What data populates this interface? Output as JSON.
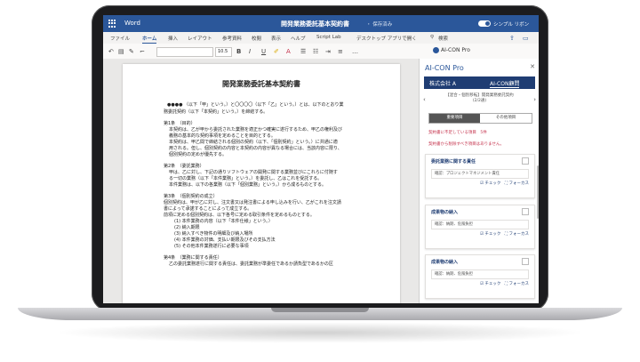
{
  "titlebar": {
    "app": "Word",
    "doc_title": "開発業務委託基本契約書",
    "saved": "・ 保存済み",
    "simple_ribbon": "シンプル リボン"
  },
  "tabs": [
    "ファイル",
    "ホーム",
    "挿入",
    "レイアウト",
    "参考資料",
    "校閲",
    "表示",
    "ヘルプ",
    "Script Lab",
    "デスクトップ アプリで開く",
    "検索"
  ],
  "toolbar": {
    "font_size": "10.5",
    "bold": "B",
    "italic": "I",
    "underline": "U",
    "addin": "AI-CON Pro"
  },
  "document": {
    "title": "開発業務委託基本契約書",
    "lines": [
      "●●●● （以下「甲」という。）と〇〇〇〇（以下「乙」という。）とは、以下のとおり業",
      "務委託契約（以下「本契約」という。）を締結する。",
      "第1条　（目的）",
      "本契約は、乙が甲から委託された業務を適正かつ確実に遂行するため、甲乙の権利及び",
      "義務の基本的な契約事項を定めることを目的とする。",
      "本契約は、甲乙間で締結される個別の契約（以下、「個別契約」という。）に共通に適",
      "用される。但し、個別契約の内容と本契約の内容が異なる場合には、当該内容に限り、",
      "個別契約の定めが優先する。",
      "第2条　（委託業務）",
      "甲は、乙に対し、下記の通りソフトウェアの開発に関する業務並びにこれらに付随す",
      "る一切の業務（以下「本件業務」という。）を委託し、乙はこれを受託する。",
      "本件業務は、以下の各業務（以下「個別業務」という。）から成るものとする。",
      "第3条　（個別契約の成立）",
      "個別契約は、甲が乙に対し、注文書又は発注書による申し込みを行い、乙がこれを注文請",
      "書によって承諾することによって成立する。",
      "前項に定める個別契約は、以下各号に定める取引条件を定めるものとする。",
      "(1) 本件業務の内容（以下「本件仕様」という。）",
      "(2) 納入期限",
      "(3) 納入すべき物件の明細及び納入場所",
      "(4) 本件業務の対価、支払い期限及びその支払方法",
      "(5) その他本件業務遂行に必要な事項",
      "第4条　（業務に関する責任）",
      "乙の委託業務遂行に関する責任は、委託業務が準委任であるか請負型であるかの区"
    ]
  },
  "panel": {
    "header": "AI-CON Pro",
    "company": "株式会社 A",
    "party": "AI-CON顧問",
    "nav_title_1": "【混合・個別移転】開発業務委託契約",
    "nav_title_2": "(2/2通)",
    "tab_main": "重要項目",
    "tab_other": "その他項目",
    "warn_1": "契約書に不足している項目　5件",
    "warn_2": "契約書から削除すべき項目はありません。",
    "cards": [
      {
        "title": "委託業務に関する責任",
        "body": "確認：プロジェクトマネジメント責任",
        "actions": "☑ チェック　⛶ フォーカス"
      },
      {
        "title": "成果物の納入",
        "body": "確認：納期、危険負担",
        "actions": "☑ チェック　⛶ フォーカス"
      },
      {
        "title": "成果物の納入",
        "body": "確認：納期、危険負担",
        "actions": "☑ チェック　⛶ フォーカス"
      }
    ]
  },
  "colors": {
    "word_blue": "#2b579a",
    "panel_navy": "#1f3d73",
    "warn_red": "#c4314b"
  }
}
